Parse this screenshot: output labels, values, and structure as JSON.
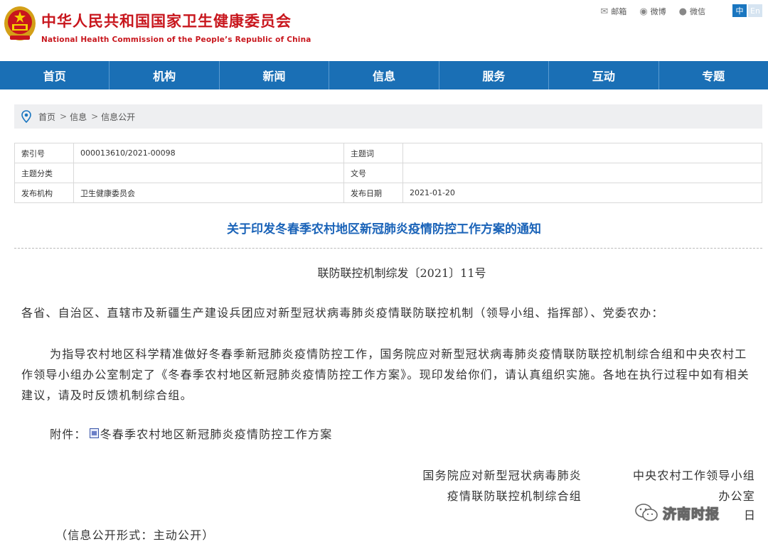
{
  "header": {
    "title_cn": "中华人民共和国国家卫生健康委员会",
    "title_en": "National Health Commission of the People’s Republic of China",
    "links": [
      {
        "label": "邮箱",
        "icon": "mail-icon"
      },
      {
        "label": "微博",
        "icon": "weibo-icon"
      },
      {
        "label": "微信",
        "icon": "wechat-icon"
      }
    ],
    "lang_cn": "中",
    "lang_en": "En"
  },
  "nav": [
    "首页",
    "机构",
    "新闻",
    "信息",
    "服务",
    "互动",
    "专题"
  ],
  "breadcrumb": [
    "首页",
    "信息",
    "信息公开"
  ],
  "info": {
    "index_label": "索引号",
    "index_value": "000013610/2021-00098",
    "subject_label": "主题词",
    "subject_value": "",
    "category_label": "主题分类",
    "category_value": "",
    "docno_label": "文号",
    "docno_value": "",
    "issuer_label": "发布机构",
    "issuer_value": "卫生健康委员会",
    "date_label": "发布日期",
    "date_value": "2021-01-20"
  },
  "doc": {
    "title": "关于印发冬春季农村地区新冠肺炎疫情防控工作方案的通知",
    "doc_number": "联防联控机制综发〔2021〕11号",
    "addressee": "各省、自治区、直辖市及新疆生产建设兵团应对新型冠状病毒肺炎疫情联防联控机制（领导小组、指挥部）、党委农办：",
    "paragraph": "为指导农村地区科学精准做好冬春季新冠肺炎疫情防控工作，国务院应对新型冠状病毒肺炎疫情联防联控机制综合组和中央农村工作领导小组办公室制定了《冬春季农村地区新冠肺炎疫情防控工作方案》。现印发给你们，请认真组织实施。各地在执行过程中如有相关建议，请及时反馈机制综合组。",
    "attachment_label": "附件：",
    "attachment_name": "冬春季农村地区新冠肺炎疫情防控工作方案",
    "sign_left_line1": "国务院应对新型冠状病毒肺炎",
    "sign_left_line2": "疫情联防联控机制综合组",
    "sign_right_line1": "中央农村工作领导小组",
    "sign_right_line2": "办公室",
    "sign_date_tail": "日",
    "footer_note": "（信息公开形式：主动公开）"
  },
  "watermark": "济南时报"
}
